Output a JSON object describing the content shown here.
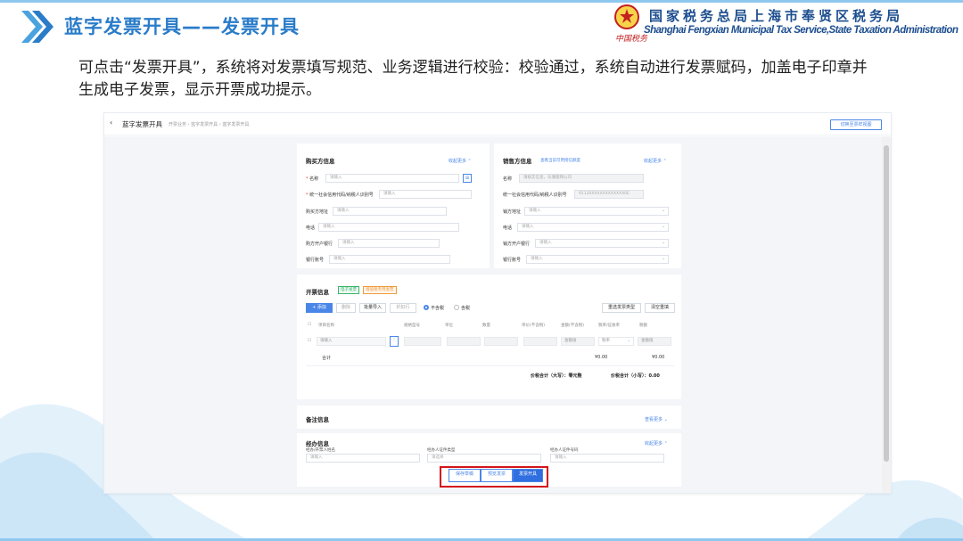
{
  "slide": {
    "title": "蓝字发票开具——发票开具",
    "bureau_cn": "国家税务总局上海市奉贤区税务局",
    "bureau_en": "Shanghai Fengxian Municipal Tax Service,State Taxation Administration",
    "logo_script": "中国税务",
    "description": "可点击“发票开具”，系统将对发票填写规范、业务逻辑进行校验：校验通过，系统自动进行发票赋码，加盖电子印章并生成电子发票，显示开票成功提示。"
  },
  "screen": {
    "header": {
      "back_icon": "‹",
      "title": "蓝字发票开具",
      "breadcrumb": "开票业务 › 蓝字发票开具 › 蓝字发票开具",
      "switch_button": "切换至票样视图"
    },
    "buyer": {
      "title": "购买方信息",
      "more": "收起更多 ⌃",
      "placeholder": "请输入",
      "fields": [
        {
          "label": "名称",
          "required": true
        },
        {
          "label": "统一社会信用代码/纳税人识别号",
          "required": true
        },
        {
          "label": "购买方地址",
          "required": false
        },
        {
          "label": "电话",
          "required": false
        },
        {
          "label": "购方开户银行",
          "required": false
        },
        {
          "label": "银行账号",
          "required": false
        }
      ]
    },
    "seller": {
      "title": "销售方信息",
      "link": "查看当前可用授信额度",
      "more": "收起更多 ⌃",
      "fields": [
        {
          "label": "名称",
          "value": "请核实信息，乐潮版网公司"
        },
        {
          "label": "统一社会信用代码/纳税人识别号",
          "value": "91120XXXXXXXXXXXX0E"
        },
        {
          "label": "销方地址",
          "value": "请输入"
        },
        {
          "label": "电话",
          "value": "请输入"
        },
        {
          "label": "销方开户银行",
          "value": "请输入"
        },
        {
          "label": "银行账号",
          "value": "请输入"
        }
      ]
    },
    "billing": {
      "title": "开票信息",
      "tag_invoice": "电子发票",
      "tag_type": "增值税专用发票",
      "buttons": [
        "+ 添加",
        "删除",
        "批量导入",
        "折扣行"
      ],
      "radio_excl": "不含税",
      "radio_incl": "含税",
      "btn_right1": "重选发票类型",
      "btn_right2": "清空重填",
      "columns": [
        "项目名称",
        "规格型号",
        "单位",
        "数量",
        "单价(不含税)",
        "金额(不含税)",
        "税率/征收率",
        "税额"
      ],
      "row": {
        "name": "请输入",
        "amount": "金额值",
        "rate": "税率",
        "tax": "金额值"
      },
      "subtotal_label": "合计",
      "subtotal_amount": "¥0.00",
      "subtotal_tax": "¥0.00",
      "total_caps_label": "价税合计（大写）：",
      "total_caps_value": "零元整",
      "total_small_label": "价税合计（小写）：",
      "total_small_value": "0.00"
    },
    "remarks": {
      "title": "备注信息",
      "more": "查看更多 ⌄"
    },
    "agent": {
      "title": "经办信息",
      "more": "收起更多 ⌃",
      "fields": [
        {
          "label": "经办/开票人姓名",
          "placeholder": "请输入"
        },
        {
          "label": "经办人证件类型",
          "placeholder": "请选择"
        },
        {
          "label": "经办人证件号码",
          "placeholder": "请输入"
        }
      ]
    },
    "actions": {
      "save": "保存草稿",
      "preview": "预览发票",
      "issue": "发票开具"
    }
  },
  "colors": {
    "title_blue": "#2a7cc9",
    "bureau_navy": "#1d4e8f",
    "accent": "#4a86e8",
    "highlight_red": "#d4151b"
  }
}
